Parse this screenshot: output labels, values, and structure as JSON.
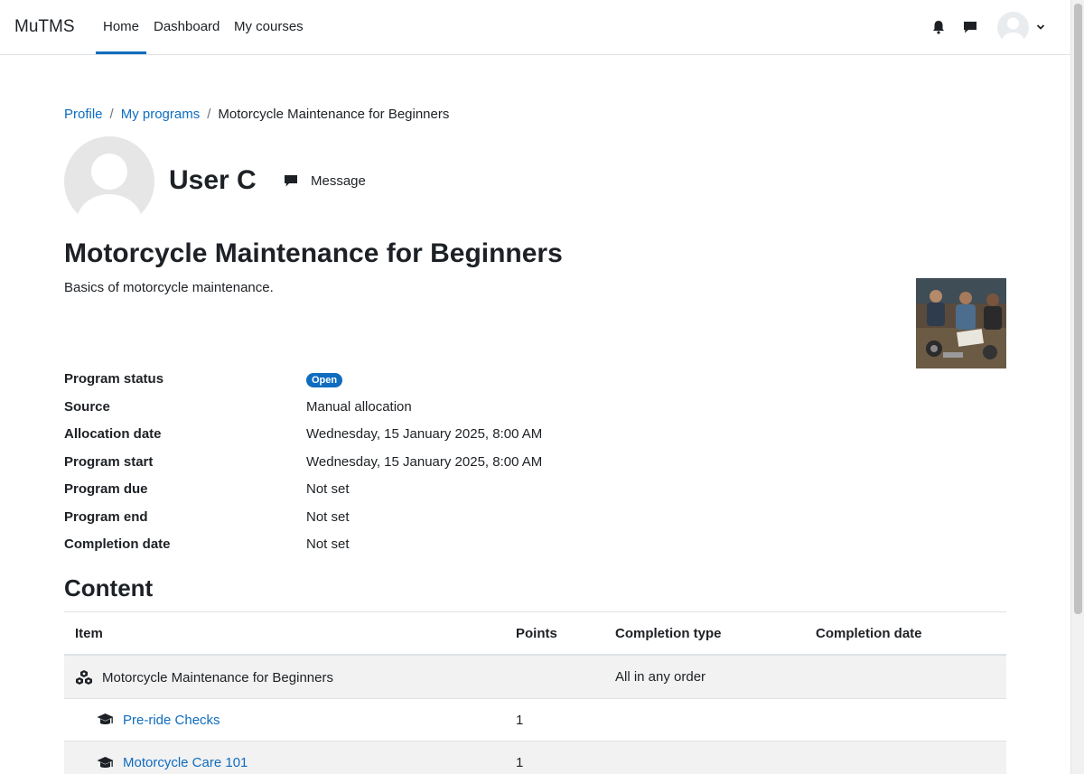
{
  "navbar": {
    "brand": "MuTMS",
    "links": [
      "Home",
      "Dashboard",
      "My courses"
    ]
  },
  "breadcrumb": {
    "items": [
      "Profile",
      "My programs"
    ],
    "current": "Motorcycle Maintenance for Beginners"
  },
  "profile": {
    "name": "User C",
    "message_label": "Message"
  },
  "program": {
    "title": "Motorcycle Maintenance for Beginners",
    "description": "Basics of motorcycle maintenance.",
    "details": [
      {
        "label": "Program status",
        "value": "Open",
        "badge": true
      },
      {
        "label": "Source",
        "value": "Manual allocation"
      },
      {
        "label": "Allocation date",
        "value": "Wednesday, 15 January 2025, 8:00 AM"
      },
      {
        "label": "Program start",
        "value": "Wednesday, 15 January 2025, 8:00 AM"
      },
      {
        "label": "Program due",
        "value": "Not set"
      },
      {
        "label": "Program end",
        "value": "Not set"
      },
      {
        "label": "Completion date",
        "value": "Not set"
      }
    ]
  },
  "content": {
    "heading": "Content",
    "headers": {
      "item": "Item",
      "points": "Points",
      "completion_type": "Completion type",
      "completion_date": "Completion date"
    },
    "rows": [
      {
        "item": "Motorcycle Maintenance for Beginners",
        "points": "",
        "completion_type": "All in any order",
        "completion_date": "",
        "icon": "cubes-icon"
      },
      {
        "item": "Pre-ride Checks",
        "points": "1",
        "completion_type": "",
        "completion_date": "",
        "icon": "graduation-cap-icon"
      },
      {
        "item": "Motorcycle Care 101",
        "points": "1",
        "completion_type": "",
        "completion_date": "",
        "icon": "graduation-cap-icon"
      }
    ]
  },
  "colors": {
    "link": "#0f6cbf",
    "badge": "#0f6cbf",
    "text": "#1d2125"
  }
}
